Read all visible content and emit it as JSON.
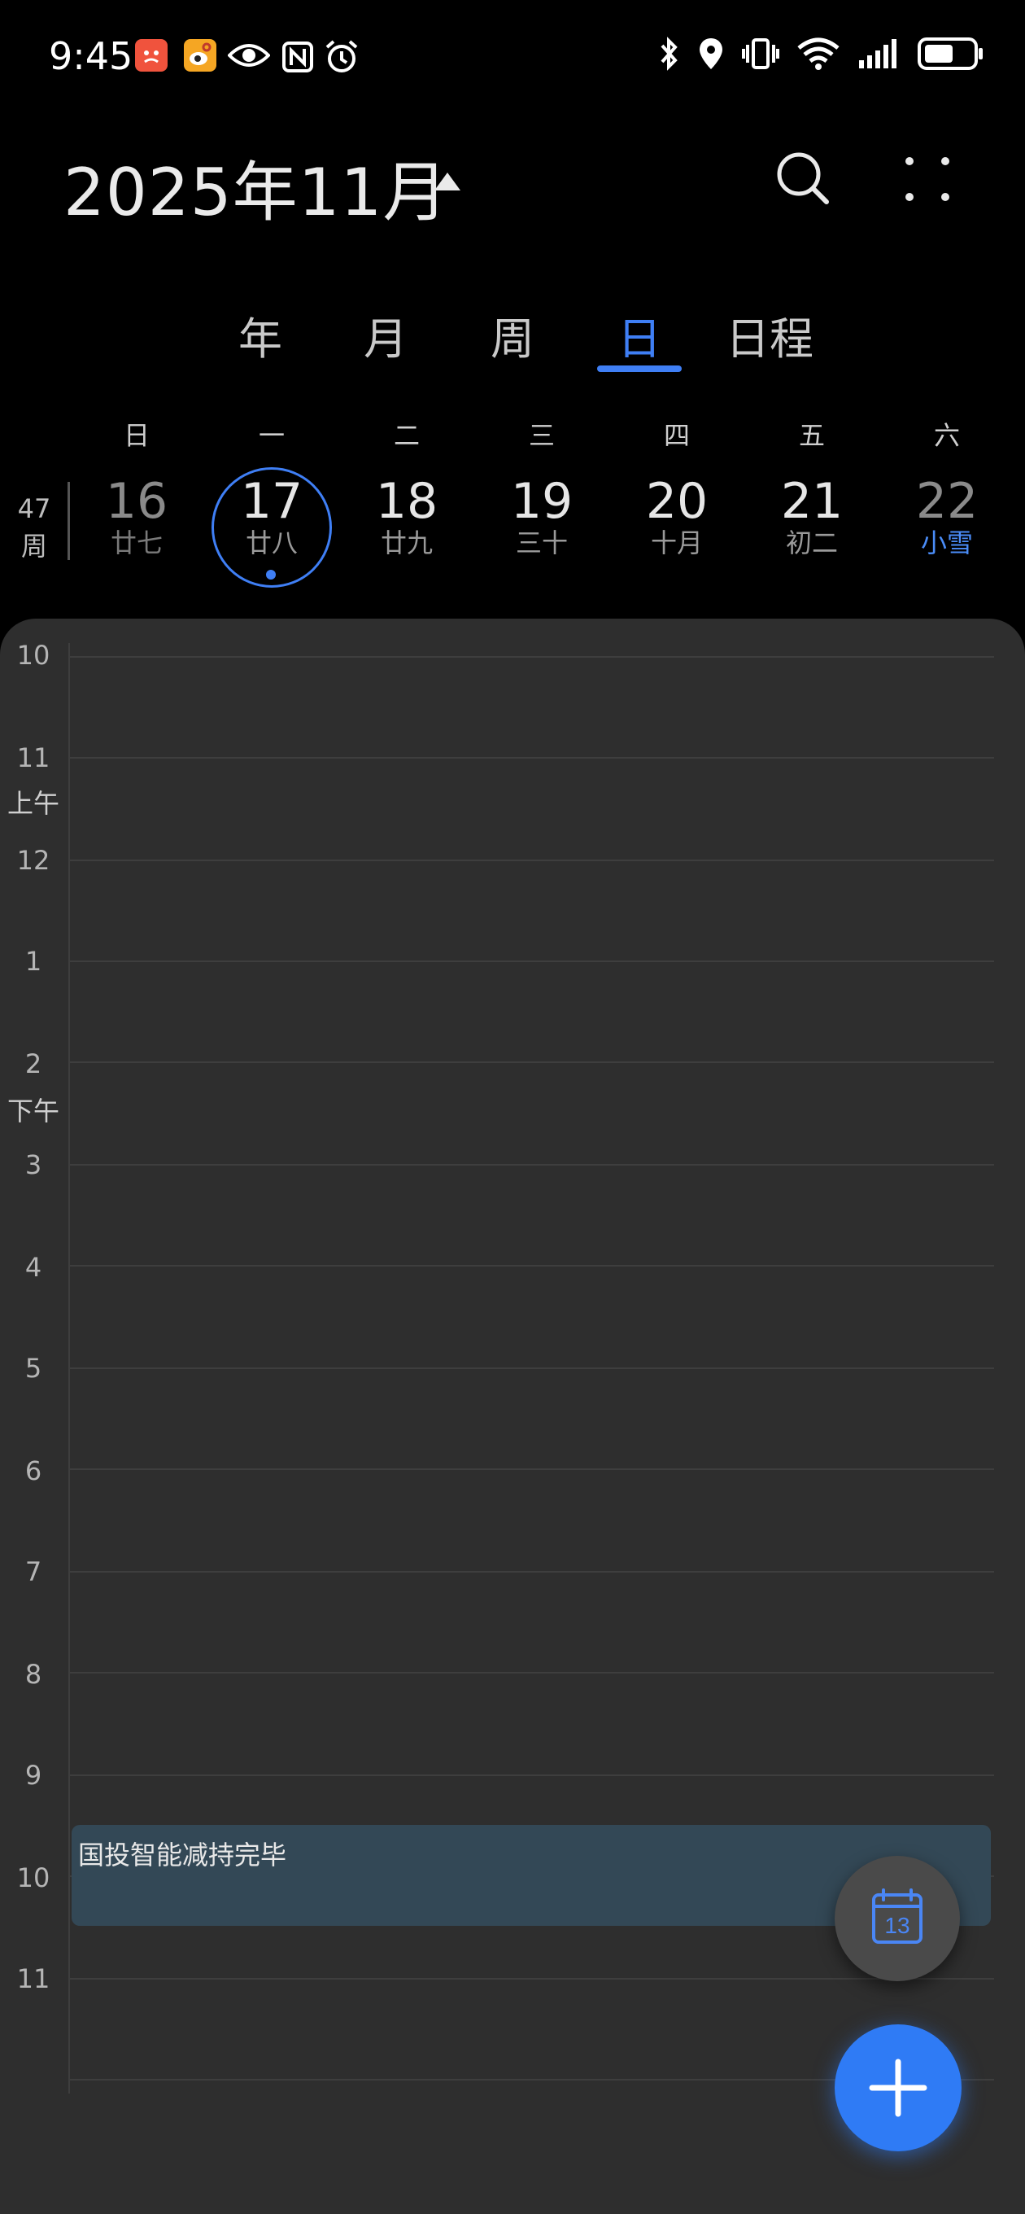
{
  "status_bar": {
    "time": "9:45",
    "accent_red": "#f0533d",
    "accent_yellow": "#f5a623"
  },
  "header": {
    "title": "2025年11月",
    "caret_icon": "triangle-up-icon",
    "search_icon": "search-icon",
    "more_icon": "more-dots-icon"
  },
  "tabs": [
    {
      "label": "年"
    },
    {
      "label": "月"
    },
    {
      "label": "周"
    },
    {
      "label": "日",
      "active": true
    },
    {
      "label": "日程"
    }
  ],
  "week": {
    "weekdays": [
      "日",
      "一",
      "二",
      "三",
      "四",
      "五",
      "六"
    ],
    "week_number": "47",
    "week_suffix": "周",
    "days": [
      {
        "num": "16",
        "lunar": "廿七"
      },
      {
        "num": "17",
        "lunar": "廿八",
        "selected": true
      },
      {
        "num": "18",
        "lunar": "廿九"
      },
      {
        "num": "19",
        "lunar": "三十"
      },
      {
        "num": "20",
        "lunar": "十月"
      },
      {
        "num": "21",
        "lunar": "初二"
      },
      {
        "num": "22",
        "lunar": "小雪"
      }
    ]
  },
  "timeline": {
    "hours": [
      "10",
      "11",
      "12",
      "1",
      "2",
      "3",
      "4",
      "5",
      "6",
      "7",
      "8",
      "9",
      "10",
      "11"
    ],
    "am_label": "上午",
    "pm_label": "下午"
  },
  "event": {
    "title": "国投智能减持完毕"
  },
  "fab": {
    "today_number": "13",
    "today_icon": "calendar-today-icon",
    "add_icon": "plus-icon"
  },
  "colors": {
    "accent_blue": "#3f7ff5",
    "background": "#000000",
    "sheet": "#2e2e2e",
    "event_bg": "#334856"
  }
}
